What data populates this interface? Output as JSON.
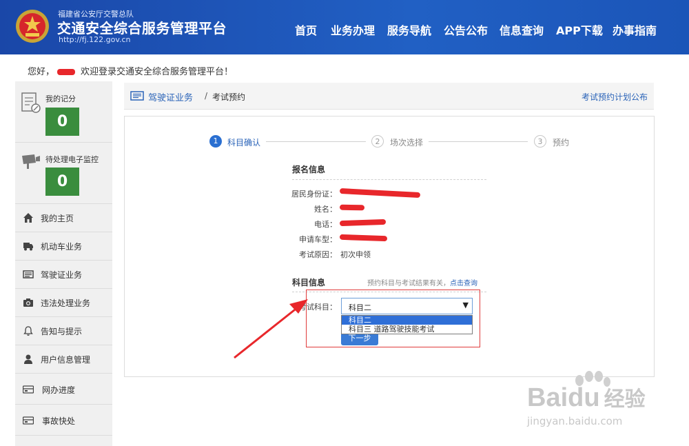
{
  "header": {
    "sub_title": "福建省公安厅交警总队",
    "title": "交通安全综合服务管理平台",
    "url": "http://fj.122.gov.cn",
    "nav": [
      "首页",
      "业务办理",
      "服务导航",
      "公告公布",
      "信息查询",
      "APP下载",
      "办事指南"
    ]
  },
  "welcome": {
    "greeting": "您好，",
    "message": "欢迎登录交通安全综合服务管理平台！"
  },
  "sidebar": {
    "scores": [
      {
        "label": "我的记分",
        "value": "0"
      },
      {
        "label": "待处理电子监控",
        "value": "0"
      }
    ],
    "items": [
      {
        "label": "我的主页",
        "icon": "home-icon"
      },
      {
        "label": "机动车业务",
        "icon": "truck-icon"
      },
      {
        "label": "驾驶证业务",
        "icon": "card-icon"
      },
      {
        "label": "违法处理业务",
        "icon": "camera-icon"
      },
      {
        "label": "告知与提示",
        "icon": "bell-icon"
      },
      {
        "label": "用户信息管理",
        "icon": "user-icon"
      },
      {
        "label": "网办进度",
        "icon": "progress-icon"
      },
      {
        "label": "事故快处",
        "icon": "accident-icon"
      }
    ]
  },
  "breadcrumb": {
    "section": "驾驶证业务",
    "separator": "/",
    "page": "考试预约",
    "link": "考试预约计划公布"
  },
  "steps": [
    {
      "num": "1",
      "label": "科目确认",
      "active": true
    },
    {
      "num": "2",
      "label": "场次选择",
      "active": false
    },
    {
      "num": "3",
      "label": "预约",
      "active": false
    }
  ],
  "registration": {
    "title": "报名信息",
    "fields": [
      {
        "label": "居民身份证：",
        "value": ""
      },
      {
        "label": "姓名：",
        "value": ""
      },
      {
        "label": "电话：",
        "value": ""
      },
      {
        "label": "申请车型：",
        "value": ""
      },
      {
        "label": "考试原因：",
        "value": "初次申领"
      }
    ]
  },
  "subject": {
    "title": "科目信息",
    "hint": "预约科目与考试结果有关，",
    "hint_link": "点击查询",
    "field_label": "考试科目：",
    "selected": "科目二",
    "options": [
      "科目二",
      "科目三 道路驾驶技能考试"
    ],
    "next_button": "下一步"
  },
  "colors": {
    "header_blue": "#1a47a8",
    "accent_blue": "#2a6fd1",
    "score_green": "#3a8d3e",
    "annotation_red": "#e03a3a"
  },
  "watermark": {
    "brand": "Bai",
    "brand2": "du",
    "brand_cn": "经验",
    "url": "jingyan.baidu.com"
  }
}
